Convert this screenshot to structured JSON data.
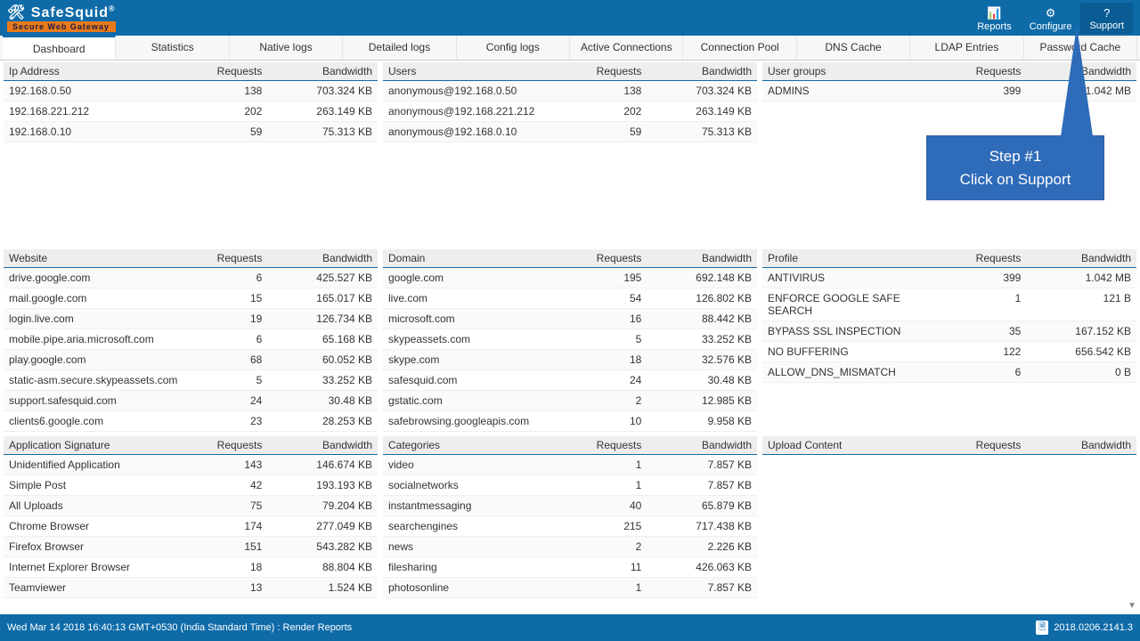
{
  "header": {
    "brand": "SafeSquid",
    "brand_sub": "Secure Web Gateway",
    "buttons": [
      {
        "icon": "📊",
        "label": "Reports"
      },
      {
        "icon": "⚙",
        "label": "Configure"
      },
      {
        "icon": "?",
        "label": "Support"
      }
    ]
  },
  "tabs": [
    "Dashboard",
    "Statistics",
    "Native logs",
    "Detailed logs",
    "Config logs",
    "Active Connections",
    "Connection Pool",
    "DNS Cache",
    "LDAP Entries",
    "Password Cache"
  ],
  "active_tab": 0,
  "panels": [
    {
      "title": "Ip Address",
      "cols": [
        "Requests",
        "Bandwidth"
      ],
      "rows": [
        [
          "192.168.0.50",
          "138",
          "703.324 KB"
        ],
        [
          "192.168.221.212",
          "202",
          "263.149 KB"
        ],
        [
          "192.168.0.10",
          "59",
          "75.313 KB"
        ]
      ]
    },
    {
      "title": "Users",
      "cols": [
        "Requests",
        "Bandwidth"
      ],
      "rows": [
        [
          "anonymous@192.168.0.50",
          "138",
          "703.324 KB"
        ],
        [
          "anonymous@192.168.221.212",
          "202",
          "263.149 KB"
        ],
        [
          "anonymous@192.168.0.10",
          "59",
          "75.313 KB"
        ]
      ]
    },
    {
      "title": "User groups",
      "cols": [
        "Requests",
        "Bandwidth"
      ],
      "rows": [
        [
          "ADMINS",
          "399",
          "1.042 MB"
        ]
      ]
    },
    {
      "title": "Website",
      "cols": [
        "Requests",
        "Bandwidth"
      ],
      "rows": [
        [
          "drive.google.com",
          "6",
          "425.527 KB"
        ],
        [
          "mail.google.com",
          "15",
          "165.017 KB"
        ],
        [
          "login.live.com",
          "19",
          "126.734 KB"
        ],
        [
          "mobile.pipe.aria.microsoft.com",
          "6",
          "65.168 KB"
        ],
        [
          "play.google.com",
          "68",
          "60.052 KB"
        ],
        [
          "static-asm.secure.skypeassets.com",
          "5",
          "33.252 KB"
        ],
        [
          "support.safesquid.com",
          "24",
          "30.48 KB"
        ],
        [
          "clients6.google.com",
          "23",
          "28.253 KB"
        ]
      ]
    },
    {
      "title": "Domain",
      "cols": [
        "Requests",
        "Bandwidth"
      ],
      "rows": [
        [
          "google.com",
          "195",
          "692.148 KB"
        ],
        [
          "live.com",
          "54",
          "126.802 KB"
        ],
        [
          "microsoft.com",
          "16",
          "88.442 KB"
        ],
        [
          "skypeassets.com",
          "5",
          "33.252 KB"
        ],
        [
          "skype.com",
          "18",
          "32.576 KB"
        ],
        [
          "safesquid.com",
          "24",
          "30.48 KB"
        ],
        [
          "gstatic.com",
          "2",
          "12.985 KB"
        ],
        [
          "safebrowsing.googleapis.com",
          "10",
          "9.958 KB"
        ]
      ]
    },
    {
      "title": "Profile",
      "cols": [
        "Requests",
        "Bandwidth"
      ],
      "rows": [
        [
          "ANTIVIRUS",
          "399",
          "1.042 MB"
        ],
        [
          "ENFORCE GOOGLE SAFE SEARCH",
          "1",
          "121 B"
        ],
        [
          "BYPASS SSL INSPECTION",
          "35",
          "167.152 KB"
        ],
        [
          "NO BUFFERING",
          "122",
          "656.542 KB"
        ],
        [
          "ALLOW_DNS_MISMATCH",
          "6",
          "0 B"
        ]
      ]
    },
    {
      "title": "Application Signature",
      "cols": [
        "Requests",
        "Bandwidth"
      ],
      "rows": [
        [
          "Unidentified Application",
          "143",
          "146.674 KB"
        ],
        [
          "Simple Post",
          "42",
          "193.193 KB"
        ],
        [
          "All Uploads",
          "75",
          "79.204 KB"
        ],
        [
          "Chrome Browser",
          "174",
          "277.049 KB"
        ],
        [
          "Firefox Browser",
          "151",
          "543.282 KB"
        ],
        [
          "Internet Explorer Browser",
          "18",
          "88.804 KB"
        ],
        [
          "Teamviewer",
          "13",
          "1.524 KB"
        ]
      ]
    },
    {
      "title": "Categories",
      "cols": [
        "Requests",
        "Bandwidth"
      ],
      "rows": [
        [
          "video",
          "1",
          "7.857 KB"
        ],
        [
          "socialnetworks",
          "1",
          "7.857 KB"
        ],
        [
          "instantmessaging",
          "40",
          "65.879 KB"
        ],
        [
          "searchengines",
          "215",
          "717.438 KB"
        ],
        [
          "news",
          "2",
          "2.226 KB"
        ],
        [
          "filesharing",
          "11",
          "426.063 KB"
        ],
        [
          "photosonline",
          "1",
          "7.857 KB"
        ]
      ]
    },
    {
      "title": "Upload Content",
      "cols": [
        "Requests",
        "Bandwidth"
      ],
      "rows": []
    }
  ],
  "callout": {
    "line1": "Step #1",
    "line2": "Click on Support"
  },
  "footer": {
    "left": "Wed Mar 14 2018 16:40:13 GMT+0530 (India Standard Time) : Render Reports",
    "right": "2018.0206.2141.3"
  }
}
